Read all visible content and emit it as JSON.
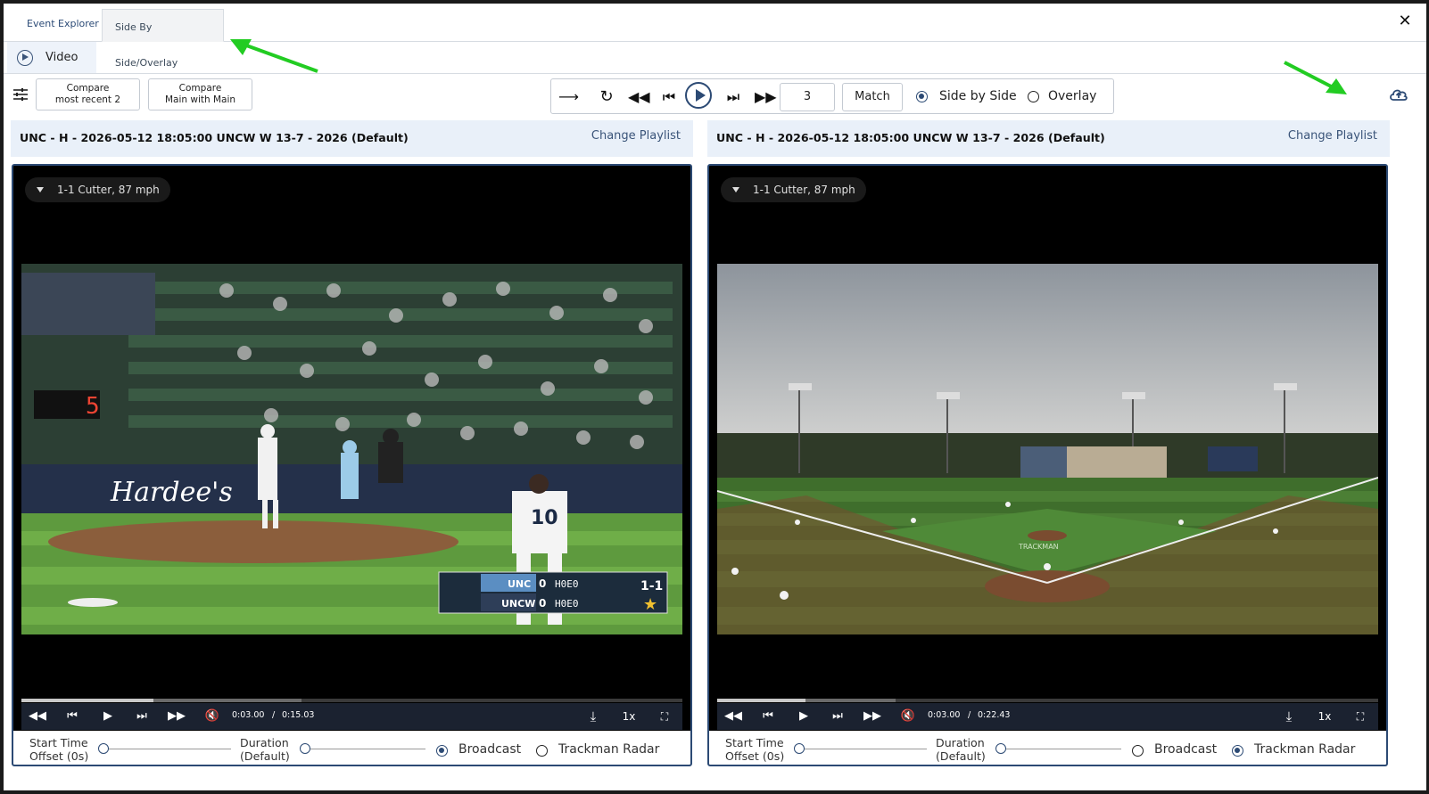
{
  "tabs": [
    {
      "label": "Event Explorer"
    },
    {
      "label": "Side By Side/Overlay"
    }
  ],
  "subtab": {
    "label": "Video"
  },
  "toolbar": {
    "compare_recent": [
      "Compare",
      "most recent 2"
    ],
    "compare_main": [
      "Compare",
      "Main with Main"
    ],
    "number_value": "3",
    "match_label": "Match",
    "side_by_side": "Side by Side",
    "overlay": "Overlay"
  },
  "left": {
    "title": "UNC - H - 2026-05-12 18:05:00 UNCW W 13-7 - 2026 (Default)",
    "change_playlist": "Change Playlist",
    "pitch": "1-1 Cutter, 87 mph",
    "time_current": "0:03.00",
    "time_sep": "/",
    "time_total": "0:15.03",
    "speed": "1x",
    "start_offset": [
      "Start Time",
      "Offset (0s)"
    ],
    "duration": [
      "Duration",
      "(Default)"
    ],
    "broadcast": "Broadcast",
    "trackman": "Trackman Radar",
    "progress": 0.2,
    "buffered": 0.424
  },
  "right": {
    "title": "UNC - H - 2026-05-12 18:05:00 UNCW W 13-7 - 2026 (Default)",
    "change_playlist": "Change Playlist",
    "pitch": "1-1 Cutter, 87 mph",
    "time_current": "0:03.00",
    "time_sep": "/",
    "time_total": "0:22.43",
    "speed": "1x",
    "start_offset": [
      "Start Time",
      "Offset (0s)"
    ],
    "duration": [
      "Duration",
      "(Default)"
    ],
    "broadcast": "Broadcast",
    "trackman": "Trackman Radar",
    "progress": 0.134,
    "buffered": 0.27
  },
  "scorebug": {
    "team1": "UNC",
    "score1": "0",
    "team2": "UNCW",
    "score2": "0",
    "count": "1-1",
    "hoe": "H0E0"
  },
  "ad_text": "Hardee's",
  "jersey": "10",
  "field_text": "TRACKMAN",
  "colors": {
    "accent": "#2c4a74",
    "arrow": "#22cc22"
  }
}
